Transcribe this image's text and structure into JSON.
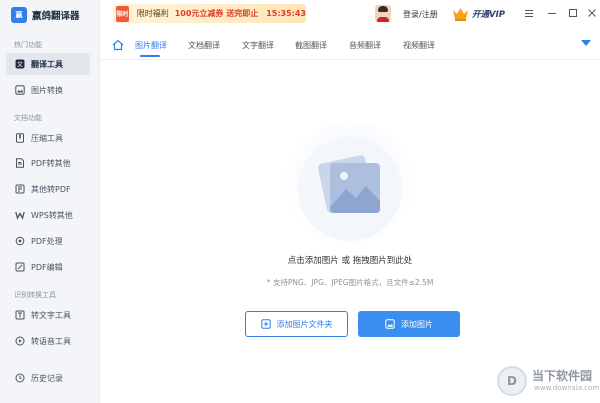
{
  "app": {
    "title": "嬴鸽翻译器",
    "logo_text": "嬴"
  },
  "sidebar": {
    "sections": [
      {
        "title": "热门功能"
      },
      {
        "title": "文档功能"
      },
      {
        "title": "识别转换工具"
      }
    ],
    "items": [
      {
        "label": "翻译工具",
        "icon": "translate-icon",
        "active": true
      },
      {
        "label": "图片转换",
        "icon": "image-convert-icon"
      },
      {
        "label": "压缩工具",
        "icon": "compress-icon"
      },
      {
        "label": "PDF转其他",
        "icon": "pdf-convert-icon"
      },
      {
        "label": "其他转PDF",
        "icon": "to-pdf-icon"
      },
      {
        "label": "WPS转其他",
        "icon": "wps-icon"
      },
      {
        "label": "PDF处理",
        "icon": "pdf-process-icon"
      },
      {
        "label": "PDF编辑",
        "icon": "pdf-edit-icon"
      },
      {
        "label": "转文字工具",
        "icon": "to-text-icon"
      },
      {
        "label": "转语音工具",
        "icon": "to-speech-icon"
      },
      {
        "label": "历史记录",
        "icon": "history-icon"
      }
    ]
  },
  "topbar": {
    "promo_gift": "限时",
    "promo_limited": "限时福利",
    "promo_offer": "100元立减券 送完即止",
    "promo_timer": "15:35:43",
    "login_label": "登录/注册",
    "vip_label": "开通VIP",
    "menu_icon": "menu-icon",
    "minimize_icon": "minimize-icon",
    "maximize_icon": "maximize-icon",
    "close_icon": "close-icon"
  },
  "tabs": [
    {
      "label": "图片翻译",
      "active": true
    },
    {
      "label": "文档翻译"
    },
    {
      "label": "文字翻译"
    },
    {
      "label": "截图翻译"
    },
    {
      "label": "音频翻译"
    },
    {
      "label": "视频翻译"
    }
  ],
  "main": {
    "drop_hint": "点击添加图片 或 拖拽图片到此处",
    "support_hint": "* 支持PNG、JPG、JPEG图片格式，且文件≤2.5M",
    "add_folder_label": "添加图片文件夹",
    "add_image_label": "添加图片"
  },
  "watermark": {
    "logo": "D",
    "title": "当下软件园",
    "url": "www.downxia.com"
  },
  "colors": {
    "accent": "#2f80ed",
    "promo_red": "#e23a2a",
    "sidebar_bg": "#f3f5f8"
  }
}
